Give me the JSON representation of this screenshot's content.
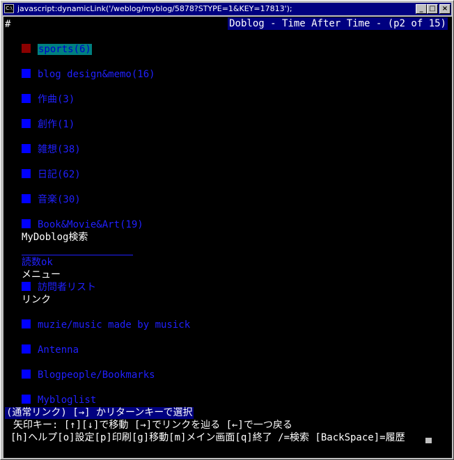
{
  "window": {
    "title": "javascript:dynamicLink('/weblog/myblog/5878?STYPE=1&KEY=17813');",
    "icon_label": "C:\\",
    "minimize_glyph": "_",
    "maximize_glyph": "□",
    "close_glyph": "×"
  },
  "header": {
    "left": "#",
    "right": "Doblog - Time After Time - (p2 of 15)"
  },
  "lines": [
    {
      "label": "sports(6)"
    },
    {
      "label": "blog design&memo(16)"
    },
    {
      "label": "作曲(3)"
    },
    {
      "label": "創作(1)"
    },
    {
      "label": "雑想(38)"
    },
    {
      "label": "日記(62)"
    },
    {
      "label": "音楽(30)"
    },
    {
      "label": "Book&Movie&Art(19)"
    },
    {
      "label": "MyDoblog検索"
    },
    {
      "label": "読数ok"
    },
    {
      "label": "メニュー"
    },
    {
      "label": "訪問者リスト"
    },
    {
      "label": "リンク"
    },
    {
      "label": "muzie/music made by musick"
    },
    {
      "label": "Antenna"
    },
    {
      "label": "Blogpeople/Bookmarks"
    },
    {
      "label": "Mybloglist"
    }
  ],
  "status": "(通常リンク) [→] かリターンキーで選択",
  "help1": "矢印キー: [↑][↓]で移動 [→]でリンクを辿る [←]で一つ戻る",
  "help2": "[h]ヘルプ[o]設定[p]印刷[g]移動[m]メイン画面[q]終了 /=検索 [BackSpace]=履歴"
}
